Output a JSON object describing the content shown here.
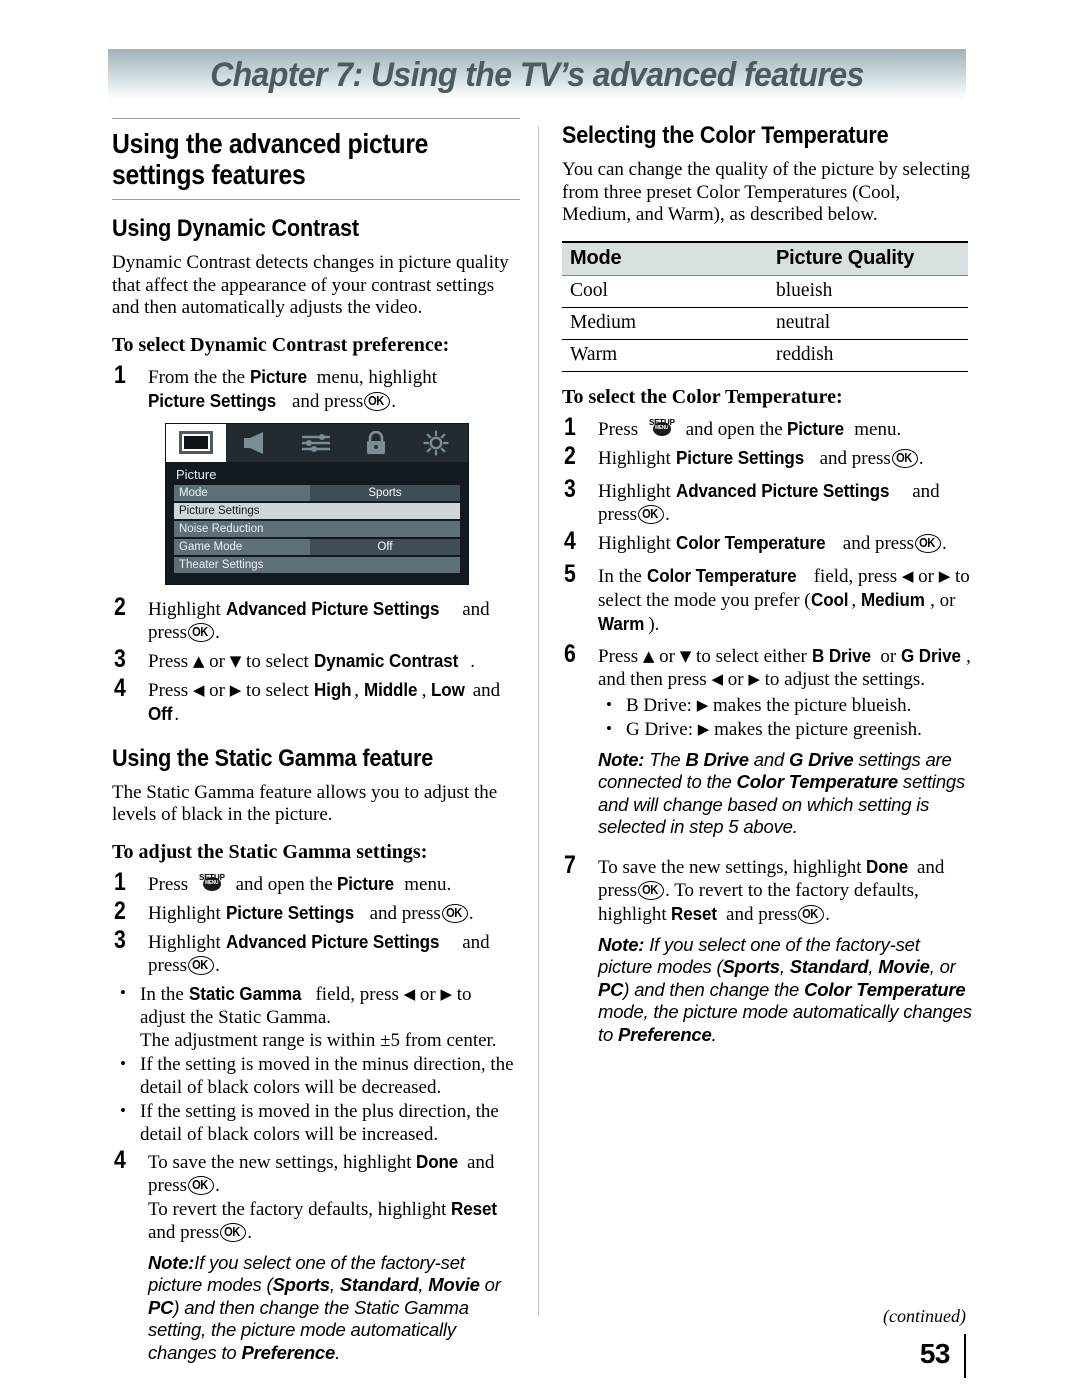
{
  "chapter": {
    "banner_title": "Chapter 7: Using the TV’s advanced features"
  },
  "left": {
    "section_title": "Using the advanced picture settings features",
    "dynamic": {
      "heading": "Using Dynamic Contrast",
      "intro": "Dynamic Contrast detects changes in picture quality that affect the appearance of your contrast settings and then automatically adjusts the video.",
      "task": "To select Dynamic Contrast preference:",
      "step1_a": "From the the",
      "step1_b": "Picture",
      "step1_c": "menu, highlight",
      "step1_d": "Picture Settings",
      "step1_e": "and press",
      "step2_a": "Highlight",
      "step2_b": "Advanced Picture Settings",
      "step2_c": "and press",
      "step3_a": "Press",
      "step3_b": "or",
      "step3_c": "to select",
      "step3_d": "Dynamic Contrast",
      "step4_a": "Press",
      "step4_b": "or",
      "step4_c": "to select",
      "step4_d": "High",
      "step4_e": "Middle",
      "step4_f": "Low",
      "step4_g": "and",
      "step4_h": "Off"
    },
    "tvmenu": {
      "title": "Picture",
      "icons": [
        "tv-picture-icon",
        "speaker-icon",
        "sliders-icon",
        "lock-icon",
        "brightness-sun-icon"
      ],
      "rows": [
        {
          "label": "Mode",
          "value": "Sports"
        },
        {
          "label": "Picture Settings",
          "value": ""
        },
        {
          "label": "Noise Reduction",
          "value": ""
        },
        {
          "label": "Game Mode",
          "value": "Off"
        },
        {
          "label": "Theater Settings",
          "value": ""
        }
      ]
    },
    "gamma": {
      "heading": "Using the Static Gamma feature",
      "intro": "The Static Gamma feature allows you to adjust the levels of black in the picture.",
      "task": "To adjust the Static Gamma settings:",
      "s1_a": "Press",
      "s1_b": "and open the",
      "s1_c": "Picture",
      "s1_d": "menu.",
      "s2_a": "Highlight",
      "s2_b": "Picture Settings",
      "s2_c": "and press",
      "s3_a": "Highlight",
      "s3_b": "Advanced Picture Settings",
      "s3_c": "and press",
      "b1_a": "In the",
      "b1_b": "Static Gamma",
      "b1_c": "field, press",
      "b1_d": "or",
      "b1_e": "to adjust the Static Gamma.",
      "b1_f": "The adjustment range is within ±5 from center.",
      "b2": "If the setting is moved in the minus direction, the detail of black colors will be decreased.",
      "b3": "If the setting is moved in the plus direction, the detail of black colors will be increased.",
      "s4_a": "To save the new settings, highlight",
      "s4_b": "Done",
      "s4_c": "and press",
      "s4_d": "To revert the factory defaults, highlight",
      "s4_e": "Reset",
      "s4_f": "and press",
      "note_label": "Note:",
      "note_1": "If you select one of the factory-set picture modes (",
      "note_m1": "Sports",
      "note_2": ", ",
      "note_m2": "Standard",
      "note_3": ", ",
      "note_m3": "Movie",
      "note_4": " or ",
      "note_m4": "PC",
      "note_5": ") and then change the Static Gamma setting, the picture mode automatically changes to ",
      "note_m5": "Preference",
      "note_6": "."
    }
  },
  "right": {
    "heading": "Selecting the Color Temperature",
    "intro": "You can change the quality of the picture by selecting from three preset Color Temperatures (Cool, Medium, and Warm), as described below.",
    "table": {
      "headers": [
        "Mode",
        "Picture Quality"
      ],
      "rows": [
        [
          "Cool",
          "blueish"
        ],
        [
          "Medium",
          "neutral"
        ],
        [
          "Warm",
          "reddish"
        ]
      ]
    },
    "task": "To select the Color Temperature:",
    "s1_a": "Press",
    "s1_b": "and open the",
    "s1_c": "Picture",
    "s1_d": "menu.",
    "s2_a": "Highlight",
    "s2_b": "Picture Settings",
    "s2_c": "and press",
    "s3_a": "Highlight",
    "s3_b": "Advanced Picture Settings",
    "s3_c": "and press",
    "s4_a": "Highlight",
    "s4_b": "Color Temperature",
    "s4_c": "and press",
    "s5_a": "In the",
    "s5_b": "Color Temperature",
    "s5_c": "field, press",
    "s5_d": "or",
    "s5_e": "to select the mode you prefer (",
    "s5_m1": "Cool",
    "s5_m2": "Medium",
    "s5_m3": "Warm",
    "s5_f": ", ",
    "s5_g": ", or ",
    "s5_h": ").",
    "s6_a": "Press",
    "s6_b": "or",
    "s6_c": "to select either",
    "s6_d": "B Drive",
    "s6_e": "or",
    "s6_f": "G Drive",
    "s6_g": ", and then press",
    "s6_h": "or",
    "s6_i": "to adjust the settings.",
    "b1_a": "B Drive:",
    "b1_b": "makes the picture blueish.",
    "b2_a": "G Drive:",
    "b2_b": "makes the picture greenish.",
    "note1_label": "Note:",
    "note1_1": "The ",
    "note1_m1": "B Drive",
    "note1_2": " and ",
    "note1_m2": "G Drive",
    "note1_3": " settings are connected to the ",
    "note1_m3": "Color Temperature",
    "note1_4": " settings and will change based on which setting is selected in step 5 above.",
    "s7_a": "To save the new settings, highlight",
    "s7_b": "Done",
    "s7_c": "and press",
    "s7_d": "To revert to the factory defaults, highlight",
    "s7_e": "Reset",
    "s7_f": "and press",
    "note2_label": "Note:",
    "note2_1": "If you select one of the factory-set picture modes (",
    "note2_m1": "Sports",
    "note2_2": ", ",
    "note2_m2": "Standard",
    "note2_3": ", ",
    "note2_m3": "Movie",
    "note2_4": ", or ",
    "note2_m4": "PC",
    "note2_5": ") and then change the ",
    "note2_m5": "Color Temperature",
    "note2_6": " mode, the picture mode automatically changes to ",
    "note2_m6": "Preference",
    "note2_7": "."
  },
  "footer": {
    "continued": "(continued)",
    "page_number": "53"
  },
  "glyphs": {
    "ok": "OK",
    "setup": "SETUP",
    "menu": "MENU",
    "up": "▲",
    "down": "▼",
    "left": "◀",
    "right": "▶"
  },
  "colors": {
    "banner_top": "#9fb3b8",
    "banner_text": "#4d5a60",
    "table_header_bg": "#d8dfe0",
    "menu_row": "#5d7076",
    "menu_highlight": "#cdd7da"
  }
}
